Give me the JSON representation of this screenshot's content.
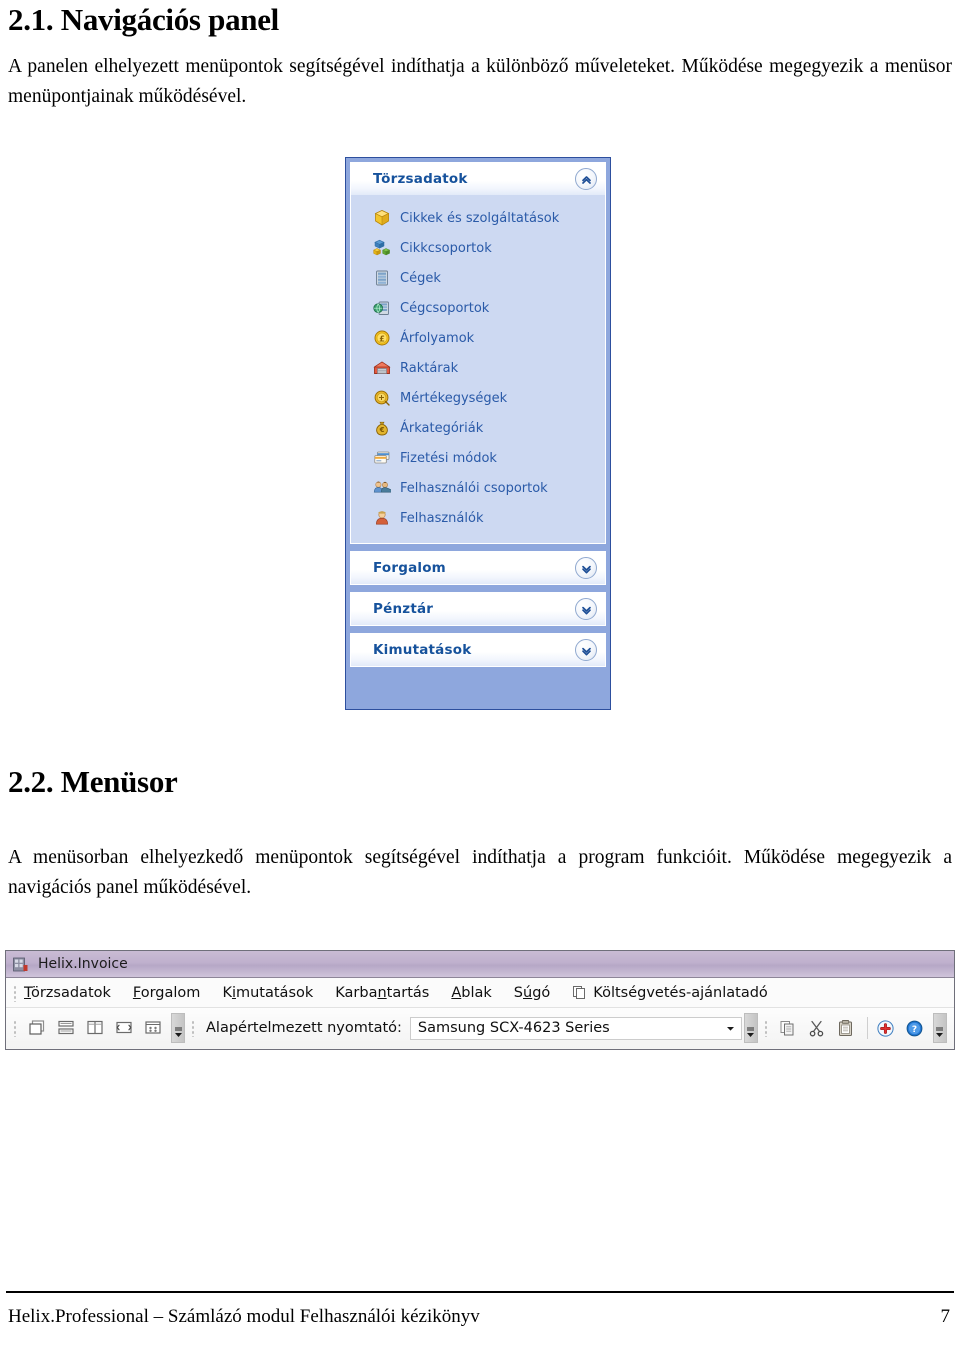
{
  "document": {
    "section_1": {
      "heading": "2.1. Navigációs panel",
      "paragraph": "A panelen elhelyezett menüpontok segítségével indíthatja a különböző műveleteket. Működése megegyezik a menüsor menüpontjainak működésével."
    },
    "section_2": {
      "heading": "2.2. Menüsor",
      "paragraph": "A menüsorban elhelyezkedő menüpontok segítségével indíthatja a program funkcióit. Működése megegyezik a navigációs panel működésével."
    },
    "footer": {
      "title": "Helix.Professional – Számlázó modul Felhasználói kézikönyv",
      "page_number": "7"
    }
  },
  "nav_panel": {
    "expanded_group": {
      "title": "Törzsadatok",
      "collapse_icon": "chevron-up-icon",
      "items": [
        {
          "label": "Cikkek és szolgáltatások",
          "icon": "yellow-box-icon"
        },
        {
          "label": "Cikkcsoportok",
          "icon": "boxes-group-icon"
        },
        {
          "label": "Cégek",
          "icon": "database-icon"
        },
        {
          "label": "Cégcsoportok",
          "icon": "database-globe-icon"
        },
        {
          "label": "Árfolyamok",
          "icon": "currency-coin-icon"
        },
        {
          "label": "Raktárak",
          "icon": "warehouse-icon"
        },
        {
          "label": "Mértékegységek",
          "icon": "measure-coin-icon"
        },
        {
          "label": "Árkategóriák",
          "icon": "money-bag-icon"
        },
        {
          "label": "Fizetési módok",
          "icon": "credit-cards-icon"
        },
        {
          "label": "Felhasználói csoportok",
          "icon": "user-group-icon"
        },
        {
          "label": "Felhasználók",
          "icon": "user-icon"
        }
      ]
    },
    "collapsed_groups": [
      {
        "title": "Forgalom",
        "expand_icon": "chevron-down-icon"
      },
      {
        "title": "Pénztár",
        "expand_icon": "chevron-down-icon"
      },
      {
        "title": "Kimutatások",
        "expand_icon": "chevron-down-icon"
      }
    ],
    "colors": {
      "panel_background": "#8ea7dd",
      "item_area": "#cdd9f2",
      "title_text": "#16529c",
      "item_text": "#2a5aa8"
    }
  },
  "menubar_window": {
    "title": "Helix.Invoice",
    "app_icon": "app-icon",
    "menu_items": [
      {
        "label": "Törzsadatok",
        "accelerator": "T"
      },
      {
        "label": "Forgalom",
        "accelerator": "F"
      },
      {
        "label": "Kimutatások",
        "accelerator": "i"
      },
      {
        "label": "Karbantartás",
        "accelerator": "n"
      },
      {
        "label": "Ablak",
        "accelerator": "A"
      },
      {
        "label": "Súgó",
        "accelerator": "ú"
      },
      {
        "label": "Költségvetés-ajánlatadó",
        "accelerator": "",
        "icon": "copy-pages-icon"
      }
    ],
    "toolbar": {
      "window_buttons": [
        "cascade-windows-icon",
        "tile-horizontal-icon",
        "tile-vertical-icon",
        "arrange-icons-icon",
        "window-list-icon"
      ],
      "overflow_icon": "toolbar-overflow-icon",
      "printer_label": "Alapértelmezett nyomtató:",
      "printer_value": "Samsung SCX-4623 Series",
      "printer_dropdown_icon": "chevron-down-icon",
      "edit_buttons": [
        "copy-icon",
        "cut-icon",
        "paste-icon",
        "add-icon",
        "help-icon"
      ]
    },
    "colors": {
      "title_bar": "#bfb0cd",
      "add_icon": "#e03030",
      "help_icon": "#2277d4"
    }
  }
}
